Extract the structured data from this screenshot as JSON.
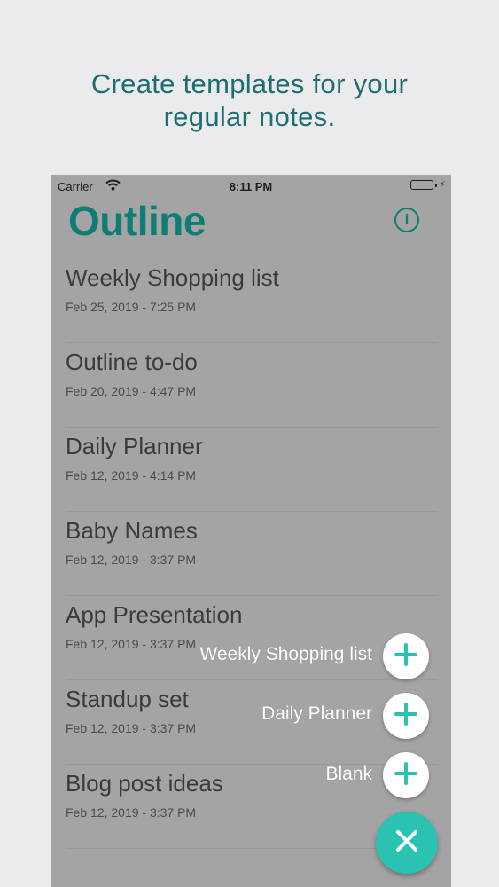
{
  "headline": {
    "line1": "Create templates for your",
    "line2": "regular notes."
  },
  "status_bar": {
    "carrier": "Carrier",
    "time": "8:11 PM",
    "battery_color": "#5ecb3a"
  },
  "app": {
    "title": "Outline",
    "info_icon": "info-circle-icon",
    "accent_color": "#0f7d76"
  },
  "notes": [
    {
      "title": "Weekly Shopping list",
      "date": "Feb 25, 2019 - 7:25 PM"
    },
    {
      "title": "Outline to-do",
      "date": "Feb 20, 2019 - 4:47 PM"
    },
    {
      "title": "Daily Planner",
      "date": "Feb 12, 2019 - 4:14 PM"
    },
    {
      "title": "Baby Names",
      "date": "Feb 12, 2019 - 3:37 PM"
    },
    {
      "title": "App Presentation",
      "date": "Feb 12, 2019 - 3:37 PM"
    },
    {
      "title": "Standup set",
      "date": "Feb 12, 2019 - 3:37 PM"
    },
    {
      "title": "Blog post ideas",
      "date": "Feb 12, 2019 - 3:37 PM"
    }
  ],
  "fab_menu": {
    "options": [
      {
        "label": "Weekly Shopping list",
        "icon": "plus-icon"
      },
      {
        "label": "Daily Planner",
        "icon": "plus-icon"
      },
      {
        "label": "Blank",
        "icon": "plus-icon"
      }
    ],
    "close_icon": "close-icon",
    "fab_color": "#2ac3b2"
  }
}
